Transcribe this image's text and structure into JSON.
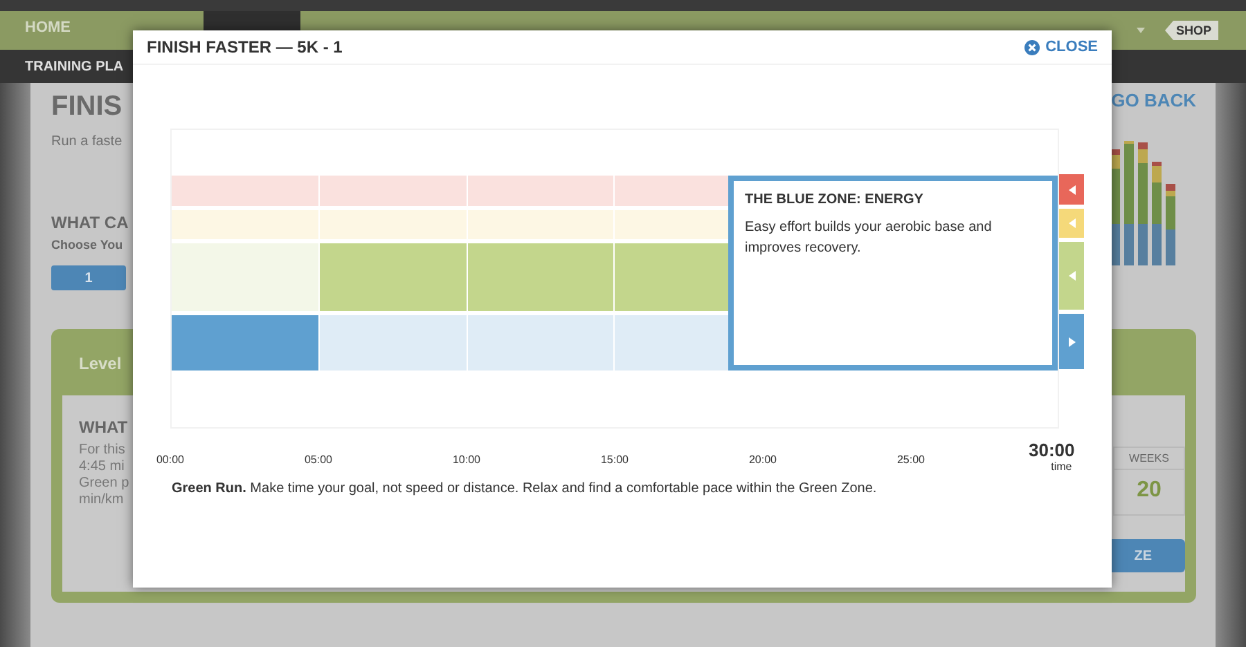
{
  "nav": {
    "home": "HOME",
    "shop": "SHOP"
  },
  "subnav": {
    "label": "TRAINING PLA"
  },
  "page": {
    "title": "FINIS",
    "subtitle": "Run a faste",
    "go_back": "GO BACK",
    "section_title": "WHAT CA",
    "choose_label": "Choose You",
    "level_buttons": [
      {
        "label": "1",
        "selected": true
      }
    ],
    "panel": {
      "header": "Level",
      "heading": "WHAT",
      "lines": [
        "For this",
        "4:45 mi",
        "Green p",
        "min/km"
      ],
      "weeks_label": "WEEKS",
      "weeks_value": "20",
      "button": "ZE"
    }
  },
  "modal": {
    "title": "FINISH FASTER — 5K - 1",
    "close": "CLOSE",
    "zones": [
      {
        "color": "#e8675a",
        "selected": false,
        "cells": [
          false,
          false,
          false,
          false
        ]
      },
      {
        "color": "#f5d97a",
        "selected": false,
        "cells": [
          false,
          false,
          false,
          false
        ]
      },
      {
        "color": "#c3d68c",
        "selected": false,
        "cells": [
          false,
          true,
          true,
          true
        ]
      },
      {
        "color": "#5fa0d0",
        "selected": true,
        "cells": [
          true,
          false,
          false,
          false
        ]
      }
    ],
    "tooltip": {
      "title": "THE BLUE ZONE: ENERGY",
      "text": "Easy effort builds your aerobic base and improves recovery."
    },
    "ticks": [
      "00:00",
      "05:00",
      "10:00",
      "15:00",
      "20:00",
      "25:00"
    ],
    "total": "30:00",
    "total_label": "time",
    "description": "**Green Run.** Make time your goal, not speed or distance. Relax and find a comfortable pace within the Green Zone."
  }
}
